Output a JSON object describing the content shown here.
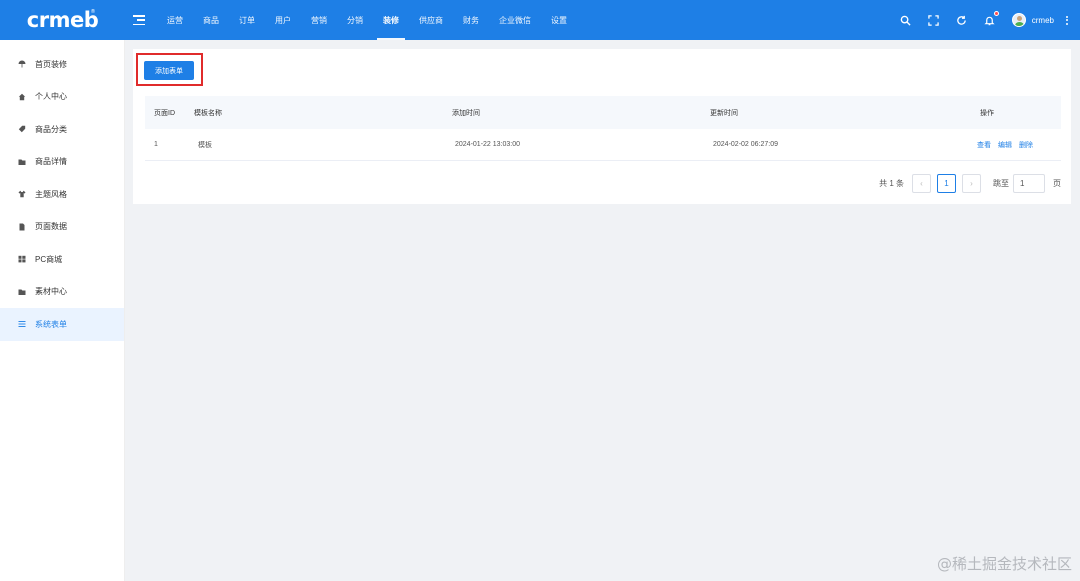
{
  "header": {
    "logo": "crmeb",
    "nav": [
      "运营",
      "商品",
      "订单",
      "用户",
      "营销",
      "分销",
      "装修",
      "供应商",
      "财务",
      "企业微信",
      "设置"
    ],
    "active_nav": "装修",
    "username": "crmeb",
    "icons": [
      "search-icon",
      "fullscreen-icon",
      "refresh-icon",
      "bell-icon",
      "more-vertical-icon"
    ],
    "accent_color": "#1e7fe6"
  },
  "sidebar": {
    "items": [
      {
        "label": "首页装修",
        "icon": "umbrella-icon"
      },
      {
        "label": "个人中心",
        "icon": "home-icon"
      },
      {
        "label": "商品分类",
        "icon": "tag-icon"
      },
      {
        "label": "商品详情",
        "icon": "folder-icon"
      },
      {
        "label": "主题风格",
        "icon": "shirt-icon"
      },
      {
        "label": "页面数据",
        "icon": "file-icon"
      },
      {
        "label": "PC商城",
        "icon": "windows-icon"
      },
      {
        "label": "素材中心",
        "icon": "folder-icon"
      },
      {
        "label": "系统表单",
        "icon": "list-icon"
      }
    ],
    "active": "系统表单"
  },
  "main": {
    "add_button": "添加表单",
    "table": {
      "headers": [
        "页面ID",
        "模板名称",
        "添加时间",
        "更新时间",
        "操作"
      ],
      "rows": [
        {
          "id": "1",
          "name": "模板",
          "created": "2024-01-22 13:03:00",
          "updated": "2024-02-02 06:27:09",
          "actions": [
            "查看",
            "编辑",
            "删除"
          ]
        }
      ]
    },
    "pagination": {
      "total": "共 1 条",
      "prev": "‹",
      "current_page": "1",
      "next": "›",
      "jump_label": "跳至",
      "jump_value": "1",
      "unit": "页"
    }
  },
  "watermark": "@稀土掘金技术社区"
}
